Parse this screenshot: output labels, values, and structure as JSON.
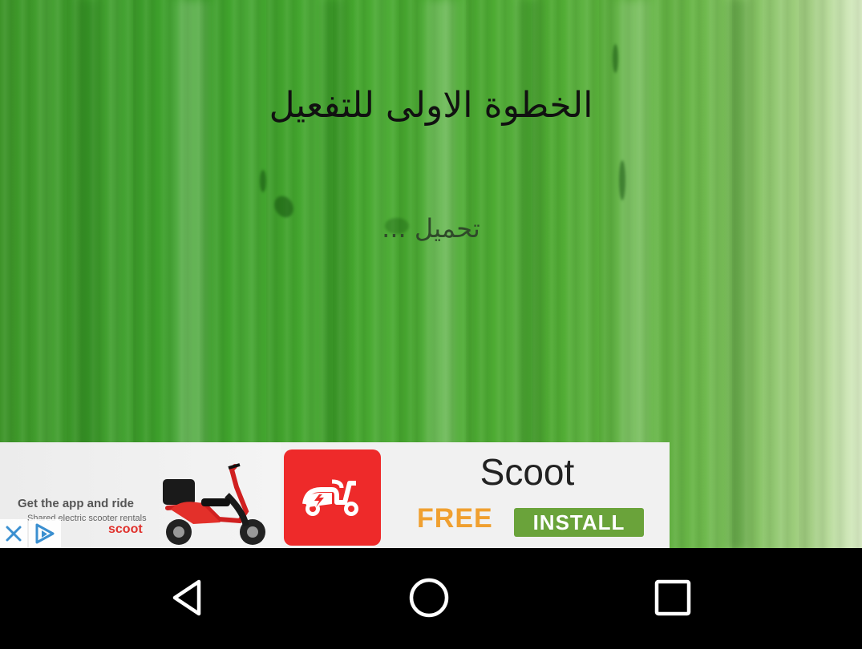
{
  "app": {
    "title": "الخطوة الاولى للتفعيل",
    "loading_text": "تحميل ..."
  },
  "ad": {
    "brand_name": "Scoot",
    "price_label": "FREE",
    "install_label": "INSTALL",
    "tagline": "Get the app and ride",
    "subline": "Shared electric scooter rentals",
    "brand_small": "scoot",
    "icon": "scooter-icon",
    "close_icon": "close-icon",
    "adchoices_icon": "adchoices-icon",
    "colors": {
      "icon_bg": "#ee2a2a",
      "install_bg": "#6aa33a",
      "free_text": "#f0a030"
    }
  },
  "nav": {
    "back_icon": "back-triangle-icon",
    "home_icon": "home-circle-icon",
    "recents_icon": "recents-square-icon"
  },
  "theme": {
    "background": "#47a92f"
  }
}
